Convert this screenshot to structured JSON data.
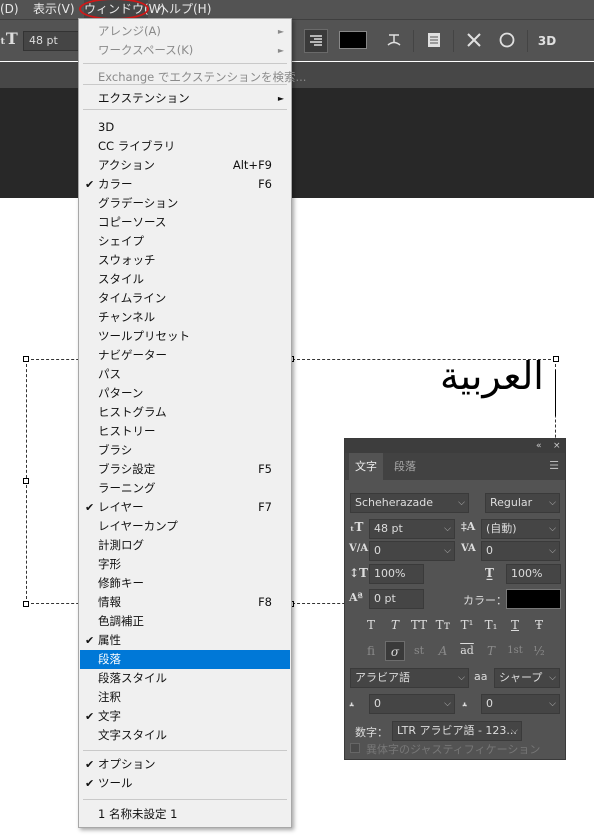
{
  "menubar": {
    "items": [
      "(D)",
      "表示(V)",
      "ウィンドウ(W)",
      "ヘルプ(H)"
    ]
  },
  "optionsbar": {
    "font_size": "48 pt",
    "threed_label": "3D"
  },
  "window_menu": {
    "items": [
      {
        "label": "アレンジ(A)",
        "disabled": true,
        "submenu": true
      },
      {
        "label": "ワークスペース(K)",
        "disabled": true,
        "submenu": true
      },
      {
        "label": "Exchange でエクステンションを検索...",
        "disabled": true
      },
      {
        "label": "エクステンション",
        "submenu": true
      },
      {
        "label": "3D"
      },
      {
        "label": "CC ライブラリ"
      },
      {
        "label": "アクション",
        "shortcut": "Alt+F9"
      },
      {
        "label": "カラー",
        "shortcut": "F6",
        "checked": true
      },
      {
        "label": "グラデーション"
      },
      {
        "label": "コピーソース"
      },
      {
        "label": "シェイプ"
      },
      {
        "label": "スウォッチ"
      },
      {
        "label": "スタイル"
      },
      {
        "label": "タイムライン"
      },
      {
        "label": "チャンネル"
      },
      {
        "label": "ツールプリセット"
      },
      {
        "label": "ナビゲーター"
      },
      {
        "label": "パス"
      },
      {
        "label": "パターン"
      },
      {
        "label": "ヒストグラム"
      },
      {
        "label": "ヒストリー"
      },
      {
        "label": "ブラシ"
      },
      {
        "label": "ブラシ設定",
        "shortcut": "F5"
      },
      {
        "label": "ラーニング"
      },
      {
        "label": "レイヤー",
        "shortcut": "F7",
        "checked": true
      },
      {
        "label": "レイヤーカンプ"
      },
      {
        "label": "計測ログ"
      },
      {
        "label": "字形"
      },
      {
        "label": "修飾キー"
      },
      {
        "label": "情報",
        "shortcut": "F8"
      },
      {
        "label": "色調補正"
      },
      {
        "label": "属性",
        "checked": true
      },
      {
        "label": "段落",
        "highlighted": true
      },
      {
        "label": "段落スタイル"
      },
      {
        "label": "注釈"
      },
      {
        "label": "文字",
        "checked": true
      },
      {
        "label": "文字スタイル"
      },
      {
        "label": "オプション",
        "checked": true
      },
      {
        "label": "ツール",
        "checked": true
      },
      {
        "label": "1 名称未設定 1"
      }
    ],
    "checkmark": "✔",
    "submenu_arrow": "►"
  },
  "canvas": {
    "arabic_text": "العربية"
  },
  "character_panel": {
    "collapse_glyph": "«",
    "close_glyph": "×",
    "tabs": [
      "文字",
      "段落"
    ],
    "font_family": "Scheheraz﻿ade",
    "font_style": "Regular",
    "font_size": "48 pt",
    "leading": "(自動)",
    "kerning": "0",
    "tracking": "0",
    "vertical_scale": "100%",
    "horizontal_scale": "100%",
    "baseline_shift": "0 pt",
    "color_label": "カラー：",
    "style_buttons": [
      "T",
      "T",
      "TT",
      "Tт",
      "T¹",
      "T₁",
      "T",
      "Ŧ"
    ],
    "opentype_buttons": [
      "fi",
      "σ",
      "st",
      "A",
      "ad",
      "T",
      "1st",
      "½"
    ],
    "language": "アラビア語",
    "antialias_label": "aa",
    "antialias": "シャープ",
    "diacritic_x": "0",
    "diacritic_y": "0",
    "digits_label": "数字：",
    "digits_value": "LTR アラビア語 - 123...",
    "justification_label": "異体字のジャスティフィケーション"
  },
  "colors": {
    "menu_highlight": "#0078d7",
    "panel_bg": "#535353",
    "annotation_red": "#d01818"
  }
}
